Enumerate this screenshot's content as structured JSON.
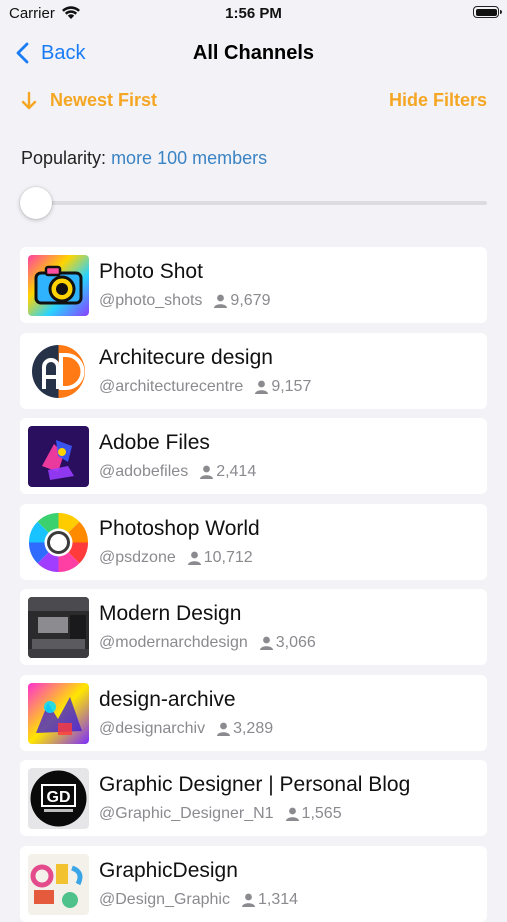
{
  "status": {
    "carrier": "Carrier",
    "time": "1:56 PM"
  },
  "nav": {
    "back": "Back",
    "title": "All Channels"
  },
  "sort": {
    "label": "Newest First",
    "hide_filters": "Hide Filters"
  },
  "filter": {
    "label": "Popularity:",
    "value": "more 100 members",
    "slider_fraction": 0
  },
  "colors": {
    "accent_blue": "#1a7cf5",
    "accent_orange": "#f5a623",
    "link_blue": "#3b84c4"
  },
  "channels": [
    {
      "name": "Photo Shot",
      "handle": "@photo_shots",
      "members": "9,679",
      "icon": "camera-logo"
    },
    {
      "name": "Architecure design",
      "handle": "@architecturecentre",
      "members": "9,157",
      "icon": "ad-monogram-logo"
    },
    {
      "name": "Adobe Files",
      "handle": "@adobefiles",
      "members": "2,414",
      "icon": "adobe-files-art"
    },
    {
      "name": "Photoshop World",
      "handle": "@psdzone",
      "members": "10,712",
      "icon": "color-wheel-logo"
    },
    {
      "name": "Modern Design",
      "handle": "@modernarchdesign",
      "members": "3,066",
      "icon": "interior-photo"
    },
    {
      "name": "design-archive",
      "handle": "@designarchiv",
      "members": "3,289",
      "icon": "colorful-art"
    },
    {
      "name": "Graphic Designer | Personal Blog",
      "handle": "@Graphic_Designer_N1",
      "members": "1,565",
      "icon": "gd-circle-logo"
    },
    {
      "name": "GraphicDesign",
      "handle": "@Design_Graphic",
      "members": "1,314",
      "icon": "letters-collage"
    }
  ]
}
